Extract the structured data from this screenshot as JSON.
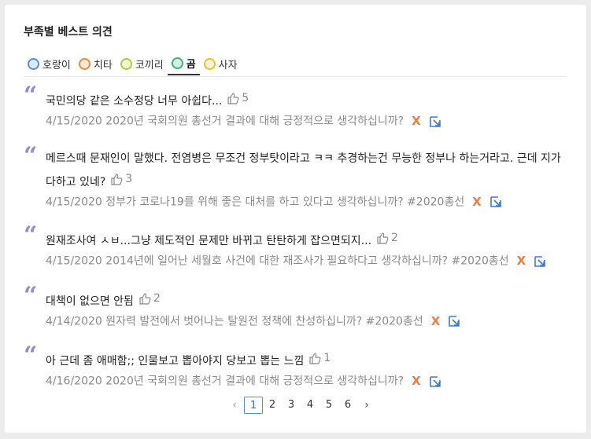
{
  "widget_title": "부족별 베스트 의견",
  "tabs": [
    {
      "label": "호랑이",
      "icon": "tiger-icon",
      "color": "#5a8fd6",
      "active": false
    },
    {
      "label": "치타",
      "icon": "cheetah-icon",
      "color": "#e68a3c",
      "active": false
    },
    {
      "label": "코끼리",
      "icon": "elephant-icon",
      "color": "#b3c93a",
      "active": false
    },
    {
      "label": "곰",
      "icon": "bear-icon",
      "color": "#3cb371",
      "active": true
    },
    {
      "label": "사자",
      "icon": "lion-icon",
      "color": "#e6c029",
      "active": false
    }
  ],
  "opinions": [
    {
      "text": "국민의당 같은 소수정당 너무 아쉽다...",
      "likes": "5",
      "meta": "4/15/2020 2020년 국회의원 총선거 결과에 대해 긍정적으로 생각하십니까?"
    },
    {
      "text": "메르스때 문재인이 말했다. 전염병은 무조건 정부탓이라고 ㅋㅋ 추경하는건 무능한 정부나 하는거라고. 근데 지가 다하고 있네?",
      "likes": "3",
      "meta": "4/15/2020 정부가 코로나19를 위해 좋은 대처를 하고 있다고 생각하십니까? #2020총선"
    },
    {
      "text": "원재조사여 ㅅㅂ...그냥 제도적인 문제만 바뀌고 탄탄하게 잡으면되지...",
      "likes": "2",
      "meta": "4/15/2020 2014년에 일어난 세월호 사건에 대한 재조사가 필요하다고 생각하십니까? #2020총선"
    },
    {
      "text": "대책이 없으면 안됨",
      "likes": "2",
      "meta": "4/14/2020 원자력 발전에서 벗어나는 탈원전 정책에 찬성하십니까? #2020총선"
    },
    {
      "text": "아 근데 좀 애매함;; 인물보고 뽑아야지 당보고 뽑는 느낌",
      "likes": "1",
      "meta": "4/16/2020 2020년 국회의원 총선거 결과에 대해 긍정적으로 생각하십니까?"
    }
  ],
  "actions": {
    "close_label": "X",
    "close_color": "#f07a3a",
    "link_color": "#3a7bd5"
  },
  "pagination": {
    "pages": [
      "1",
      "2",
      "3",
      "4",
      "5",
      "6"
    ],
    "current": "1"
  }
}
